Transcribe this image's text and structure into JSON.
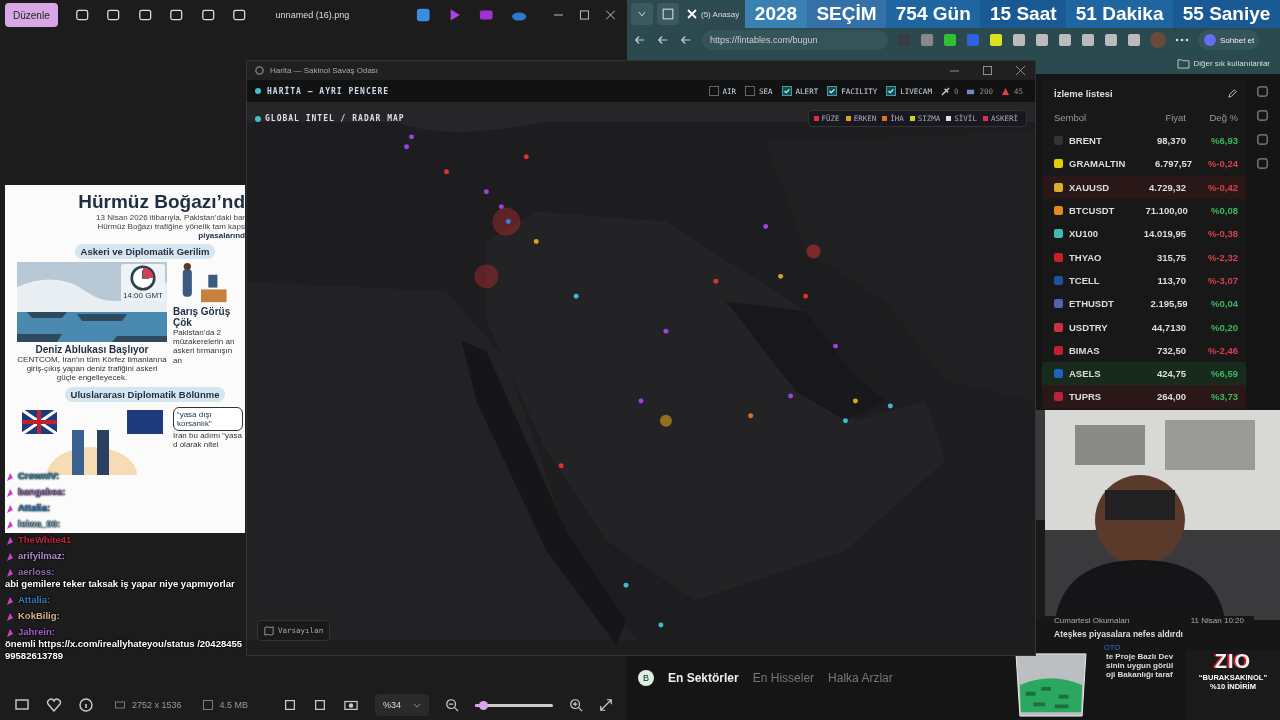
{
  "viewer": {
    "edit_button": "Düzenle",
    "file_name": "unnamed (16).png",
    "dimensions": "2752 x 1536",
    "file_size": "4.5 MB",
    "zoom": "%34",
    "zoom_slider": {
      "level": 0.1
    }
  },
  "infographic": {
    "title": "Hürmüz Boğazı’nd",
    "intro": [
      "13 Nisan 2026 itibarıyla, Pakistan’daki bar",
      "Hürmüz Boğazı trafiğine yönelik tam kaps",
      "piyasalarınd"
    ],
    "section_1": "Askeri ve Diplomatik Gerilim",
    "clock_label": "14:00 GMT",
    "card_1": {
      "title": "Deniz Ablukası Başlıyor",
      "body": "CENTCOM, İran’ın tüm Körfez limanlarına giriş-çıkış yapan deniz trafiğini askeri güçle engelleyecek."
    },
    "card_2": {
      "title": "Barış Görüş Çök",
      "body": "Pakistan’da 2 müzakerelerin an askeri tırmanışın an"
    },
    "section_2": "Uluslararası Diplomatik Bölünme",
    "quote": "“yasa dışı korsanlık”",
    "caption_2": "İran bu adımı “yasa d olarak nitel"
  },
  "chat": [
    {
      "user": "CrownIV:",
      "color": "#3a8fb0"
    },
    {
      "user": "bangabea:",
      "color": "#8a6fb0"
    },
    {
      "user": "Attalia:",
      "color": "#2f7fc0"
    },
    {
      "user": "leiwa_00:",
      "color": "#7aa7c7"
    },
    {
      "user": "TheWhite41",
      "color": "#c0203a"
    },
    {
      "user": "arifyilmaz:",
      "color": "#b08ad0"
    },
    {
      "user": "aerloss:",
      "color": "#8a6fb0",
      "text": "abi gemilere teker taksak iş yapar niye yapmıyorlar"
    },
    {
      "user": "Attalia:",
      "color": "#2f7fc0"
    },
    {
      "user": "KokBilig:",
      "color": "#d8b48a"
    },
    {
      "user": "Jahrein:",
      "color": "#a060d0",
      "text": "önemli https://x.com/ireallyhateyou/status /2042845599582613789"
    }
  ],
  "browser": {
    "tab": "(5) Anasay",
    "url": "https://fintables.com/bugun",
    "copilot": "Sohbet et",
    "favorites": "Diğer sık kullanılanlar"
  },
  "countdown": [
    "2028",
    "SEÇİM",
    "754 Gün",
    "15 Saat",
    "51 Dakika",
    "55 Saniye"
  ],
  "map_window": {
    "title": "Harita — Sakinol Savaş Odası",
    "header": "HARİTA — AYRI PENCERE",
    "radar_title": "GLOBAL INTEL / RADAR MAP",
    "default_button": "Varsayılan",
    "layers": [
      {
        "label": "AIR",
        "checked": false
      },
      {
        "label": "SEA",
        "checked": false
      },
      {
        "label": "ALERT",
        "checked": true
      },
      {
        "label": "FACILITY",
        "checked": true
      },
      {
        "label": "LIVECAM",
        "checked": true
      }
    ],
    "counts": [
      "0",
      "200",
      "45"
    ],
    "legend": [
      {
        "label": "FÜZE",
        "color": "#e03030"
      },
      {
        "label": "ERKEN",
        "color": "#e0a020"
      },
      {
        "label": "İHA",
        "color": "#e07020"
      },
      {
        "label": "SIZMA",
        "color": "#d0d020"
      },
      {
        "label": "SİVİL",
        "color": "#e0e0e0"
      },
      {
        "label": "ASKERİ",
        "color": "#e03050"
      }
    ]
  },
  "watchlist": {
    "title": "İzleme listesi",
    "columns": [
      "Sembol",
      "Fiyat",
      "Değ %"
    ],
    "rows": [
      {
        "symbol": "BRENT",
        "price": "98,370",
        "change": "%6,93",
        "gain": true,
        "highlighted": false,
        "color": "#333333"
      },
      {
        "symbol": "GRAMALTIN",
        "price": "6.797,57",
        "change": "%-0,24",
        "gain": false,
        "highlighted": false,
        "color": "#e0d000"
      },
      {
        "symbol": "XAUUSD",
        "price": "4.729,32",
        "change": "%-0,42",
        "gain": false,
        "highlighted": true,
        "flash_down": true,
        "color": "#d8b030"
      },
      {
        "symbol": "BTCUSDT",
        "price": "71.100,00",
        "change": "%0,08",
        "gain": true,
        "highlighted": false,
        "color": "#e08a20"
      },
      {
        "symbol": "XU100",
        "price": "14.019,95",
        "change": "%-0,38",
        "gain": false,
        "highlighted": false,
        "color": "#3fb8b0"
      },
      {
        "symbol": "THYAO",
        "price": "315,75",
        "change": "%-2,32",
        "gain": false,
        "highlighted": false,
        "color": "#c8202a"
      },
      {
        "symbol": "TCELL",
        "price": "113,70",
        "change": "%-3,07",
        "gain": false,
        "highlighted": false,
        "color": "#2050a0"
      },
      {
        "symbol": "ETHUSDT",
        "price": "2.195,59",
        "change": "%0,04",
        "gain": true,
        "highlighted": false,
        "color": "#5a60b0"
      },
      {
        "symbol": "USDTRY",
        "price": "44,7130",
        "change": "%0,20",
        "gain": true,
        "highlighted": false,
        "color": "#d03040"
      },
      {
        "symbol": "BIMAS",
        "price": "732,50",
        "change": "%-2,46",
        "gain": false,
        "highlighted": false,
        "color": "#c02030"
      },
      {
        "symbol": "ASELS",
        "price": "424,75",
        "change": "%6,59",
        "gain": true,
        "highlighted": true,
        "flash_down": false,
        "color": "#2060c0"
      },
      {
        "symbol": "TUPRS",
        "price": "264,00",
        "change": "%3,73",
        "gain": true,
        "highlighted": true,
        "flash_down": true,
        "color": "#c02040"
      }
    ]
  },
  "news": [
    {
      "source": "Cumartesi Okumaları",
      "time": "11 Nisan 10:20",
      "headline": "Ateşkes piyasalara nefes aldırdı"
    },
    {
      "source": "OTO",
      "lines": [
        "te Proje Bazlı Dev",
        "sinin uygun görül",
        "oji Bakanlığı taraf"
      ]
    }
  ],
  "market_tabs": [
    {
      "label": "En Sektörler",
      "selected": true
    },
    {
      "label": "En Hisseler",
      "selected": false
    },
    {
      "label": "Halka Arzlar",
      "selected": false
    }
  ],
  "avatar": "B",
  "promo": {
    "logo": "ZIO",
    "code": "“BURAKSAKINOL”",
    "discount": "%10 İNDİRİM"
  }
}
